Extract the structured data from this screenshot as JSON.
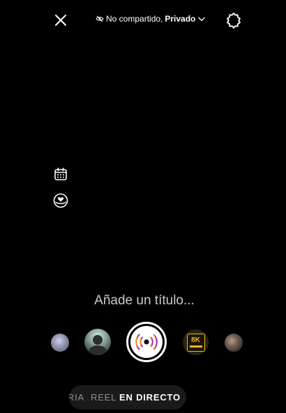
{
  "top_bar": {
    "close_icon": "close-icon",
    "privacy_icon": "eye-slash-icon",
    "privacy_status": "No compartido,",
    "privacy_value": "Privado",
    "settings_icon": "settings-gear-icon"
  },
  "side_tools": [
    {
      "name": "schedule",
      "icon": "calendar-icon"
    },
    {
      "name": "fundraiser",
      "icon": "heart-coin-icon"
    }
  ],
  "title": {
    "placeholder": "Añade un título..."
  },
  "effects": [
    {
      "name": "effect-1"
    },
    {
      "name": "effect-2"
    },
    {
      "name": "capture-live",
      "icon": "broadcast-icon"
    },
    {
      "name": "effect-8k"
    },
    {
      "name": "effect-5"
    }
  ],
  "effect_8k": {
    "label": "8K"
  },
  "modes": {
    "history": "HISTORIA",
    "reel": "REEL",
    "live": "EN DIRECTO"
  },
  "colors": {
    "background": "#000000",
    "accent_gold": "#f0b61e",
    "mode_dim": "#8e8e8e"
  }
}
